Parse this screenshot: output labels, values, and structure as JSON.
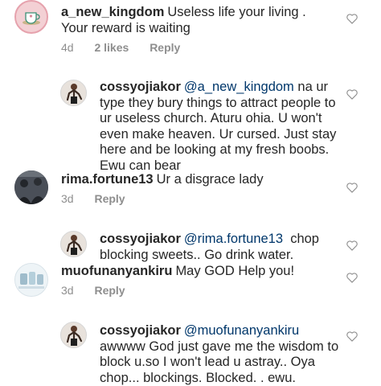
{
  "comments": [
    {
      "username": "a_new_kingdom",
      "text": "Useless life your living . Your reward is waiting",
      "time": "4d",
      "likes": "2 likes",
      "reply_label": "Reply",
      "avatar_icon": "teacup-avatar-icon"
    },
    {
      "username": "cossyojiakor",
      "mention": "@a_new_kingdom",
      "text": "na ur type they bury things to attract people to ur useless church.  Aturu ohia. U won't even make heaven.  Ur cursed. Just stay here and be looking at my fresh boobs. Ewu can bear",
      "avatar_icon": "person-avatar-icon"
    },
    {
      "username": "rima.fortune13",
      "text": "Ur a disgrace lady",
      "time": "3d",
      "reply_label": "Reply",
      "avatar_icon": "group-photo-avatar-icon"
    },
    {
      "username": "cossyojiakor",
      "mention": "@rima.fortune13",
      "text": "chop blocking sweets.. Go drink water.",
      "avatar_icon": "person-avatar-icon"
    },
    {
      "username": "muofunanyankiru",
      "text": "May GOD Help you!",
      "time": "3d",
      "reply_label": "Reply",
      "avatar_icon": "photo-avatar-icon"
    },
    {
      "username": "cossyojiakor",
      "mention": "@muofunanyankiru",
      "text": "awwww God just gave me the wisdom to block u.so I won't lead u astray.. Oya chop... blockings.  Blocked. . ewu.",
      "avatar_icon": "person-avatar-icon"
    }
  ],
  "colors": {
    "text": "#262626",
    "meta": "#8e8e8e",
    "mention": "#00376b",
    "heart_stroke": "#8e8e8e"
  },
  "icons": {
    "like": "heart-outline-icon"
  }
}
